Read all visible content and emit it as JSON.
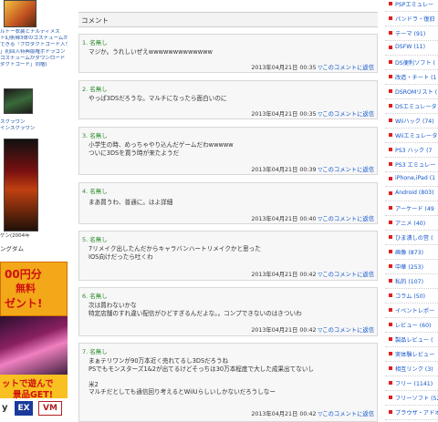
{
  "left": {
    "promo_lines": [
      "ルトー衣装とナルティメス",
      "ト幻術陣3体のコスチュームが",
      "できる「プロダクトコード入り",
      "」初回入特典版権ポドラゴン",
      "コスチュームがダウンロード",
      "ダクトコード」同梱)"
    ],
    "crown_lines": [
      "スクラウン",
      "インスクラウン"
    ],
    "small_caption": "ゲン(2004年",
    "section_label": "ングダム",
    "ad_price": "00円分",
    "ad_line2": "無料",
    "ad_line3": "ゼント!",
    "ad_bottom1": "ットで遊んで",
    "ad_bottom2": "景品GET!",
    "ad_logos": [
      "y",
      "EX",
      "VM"
    ]
  },
  "main": {
    "section_title": "コメント",
    "comments": [
      {
        "num": "1.",
        "author": "名無し",
        "lines": [
          "マジか。うれしいぜえwwwwwwwwwwwww"
        ],
        "date": "2013年04月21日 00:35",
        "reply": "▽このコメントに返信"
      },
      {
        "num": "2.",
        "author": "名無し",
        "lines": [
          "やっぱ3DSだろうな。マルチになったら面白いのに"
        ],
        "date": "2013年04月21日 00:35",
        "reply": "▽このコメントに返信"
      },
      {
        "num": "3.",
        "author": "名無し",
        "lines": [
          "小学生の時、めっちゃやり込んだゲームだわwwwww",
          "ついに3DSを買う時が来たようだ"
        ],
        "date": "2013年04月21日 00:39",
        "reply": "▽このコメントに返信"
      },
      {
        "num": "4.",
        "author": "名無し",
        "lines": [
          "まあ買うわ、普通に。はよ詳細"
        ],
        "date": "2013年04月21日 00:40",
        "reply": "▽このコメントに返信"
      },
      {
        "num": "5.",
        "author": "名無し",
        "lines": [
          "7リメイク出したんだからキャラバンハートリメイクかと思った",
          "IOS向けだったら吐くわ"
        ],
        "date": "2013年04月21日 00:42",
        "reply": "▽このコメントに返信"
      },
      {
        "num": "6.",
        "author": "名無し",
        "lines": [
          "次は買わないかな",
          "特定店舗のすれ違い配信がひどすぎるんだよな。。コンプできないのはきついわ"
        ],
        "date": "2013年04月21日 00:42",
        "reply": "▽このコメントに返信"
      },
      {
        "num": "7.",
        "author": "名無し",
        "lines": [
          "まぁテリワンが90万本近く売れてるし3DSだろうね",
          "PSでもモンスターズ1&2が出てるけどそっちは30万本程度で大した成果出てないし",
          "",
          "米2",
          "マルチだとしても通信回り考えるとWiiUらしいしかないだろうしなー"
        ],
        "date": "2013年04月21日 00:42",
        "reply": "▽このコメントに返信"
      }
    ]
  },
  "right": {
    "items": [
      "PSPエミュレー",
      "パンドラ・復旧",
      "テーマ (91)",
      "DSFW (11)",
      "DS便利ソフト (",
      "改造・チート (1",
      "DSROMリスト (",
      "DSエミュレータ",
      "Wiiハック (74)",
      "Wiiエミュレータ",
      "PS3 ハック (7",
      "PS3 エミュレー",
      "iPhone,iPad (1",
      "Android (803)",
      "アーケード (49",
      "アニメ (40)",
      "ひま潰しの営 (",
      "画像 (873)",
      "中華 (253)",
      "私的 (107)",
      "コラム (50)",
      "イベントレポー",
      "レビュー (60)",
      "製品レビュー (",
      "実体験レビュー",
      "相互リンク (3)",
      "フリー (1141)",
      "フリーソフト (52",
      "ブラウザ・アドオ"
    ]
  },
  "colors": {
    "accent": "#e02020",
    "link": "#1155cc",
    "author": "#2a8a2a"
  }
}
